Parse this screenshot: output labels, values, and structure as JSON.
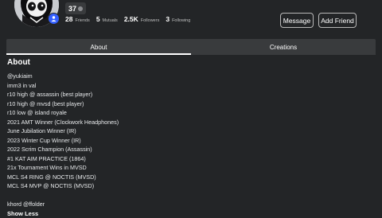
{
  "profile": {
    "level": "37",
    "stats": [
      {
        "value": "28",
        "label": "Friends"
      },
      {
        "value": "5",
        "label": "Mutuals"
      },
      {
        "value": "2.5K",
        "label": "Followers"
      },
      {
        "value": "3",
        "label": "Following"
      }
    ],
    "buttons": {
      "message": "Message",
      "add_friend": "Add Friend"
    }
  },
  "tabs": [
    {
      "label": "About",
      "active": true
    },
    {
      "label": "Creations",
      "active": false
    }
  ],
  "about": {
    "title": "About",
    "lines": [
      "@yukiaim",
      "imm3 in val",
      "r10 high @ assassin (best player)",
      "r10 high @ mvsd (best player)",
      "r10 low @ island royale",
      "2021 AMT Winner (Clockwork Headphones)",
      "June Jubilation Winner (IR)",
      "2023 Winter Cup Winner (IR)",
      "2022 Scrim Champion (Assassin)",
      "#1 KAT AIM PRACTICE (1864)",
      "21x Tournament Wins in MVSD",
      "MCL S4 RING @ NOCTIS (MVSD)",
      "MCL S4 MVP @ NOCTIS (MVSD)",
      "",
      "khord @ffolder"
    ],
    "show_less": "Show Less"
  },
  "colors": {
    "background": "#232527",
    "tab_bar": "#393b3d",
    "premium_badge": "#335fff",
    "text": "#e8eaec"
  },
  "icons": {
    "premium": "premium-icon",
    "level": "level-dot-icon"
  }
}
